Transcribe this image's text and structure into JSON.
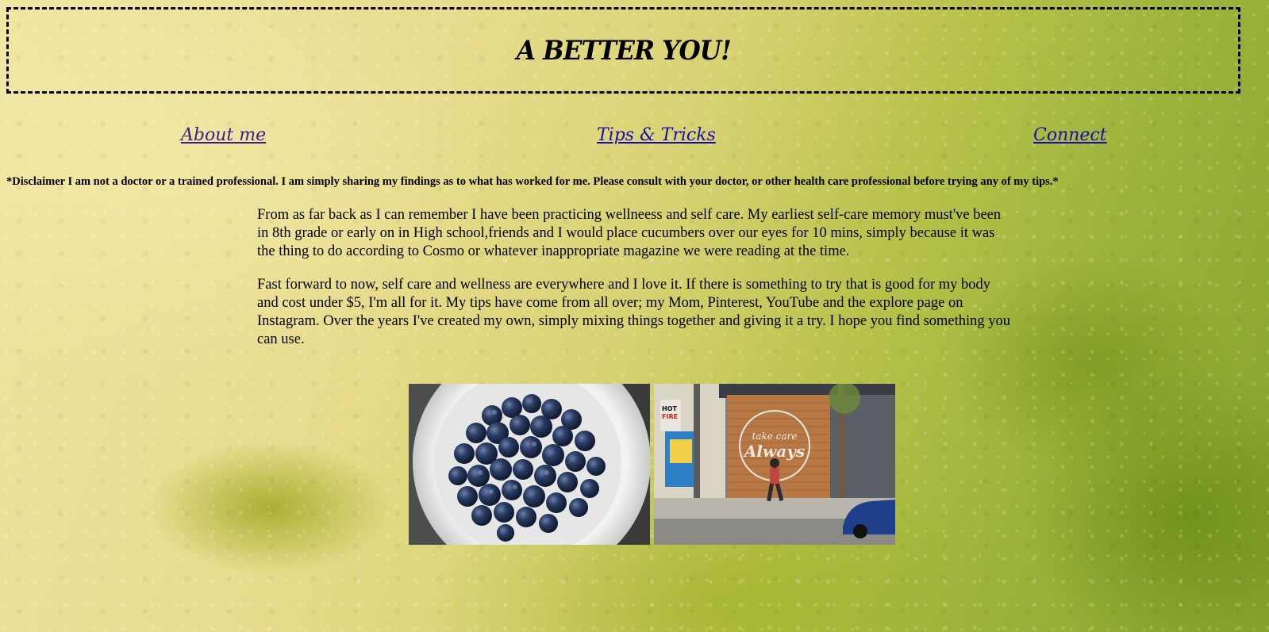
{
  "site": {
    "title": "A BETTER YOU!"
  },
  "nav": {
    "items": [
      {
        "label": "About me"
      },
      {
        "label": "Tips & Tricks"
      },
      {
        "label": "Connect"
      }
    ]
  },
  "disclaimer": "*Disclaimer I am not a doctor or a trained professional. I am simply sharing my findings as to what has worked for me. Please consult with your doctor, or other health care professional before trying any of my tips.*",
  "content": {
    "paragraphs": [
      "From as far back as I can remember I have been practicing wellneess and self care. My earliest self-care memory must've been in 8th grade or early on in High school,friends and I would place cucumbers over our eyes for 10 mins, simply because it was the thing to do according to Cosmo or whatever inappropriate magazine we were reading at the time.",
      "Fast forward to now, self care and wellness are everywhere and I love it. If there is something to try that is good for my body and cost under $5, I'm all for it. My tips have come from all over; my Mom, Pinterest, YouTube and the explore page on Instagram. Over the years I've created my own, simply mixing things together and giving it a try. I hope you find something you can use."
    ]
  },
  "gallery": {
    "photo2": {
      "shop_sign": {
        "line1": "take care",
        "line2": "Always"
      },
      "poster_text": [
        "HOT",
        "FIRE"
      ]
    }
  },
  "colors": {
    "link": "#1a0dab",
    "visited_link": "#3d1f8a"
  }
}
